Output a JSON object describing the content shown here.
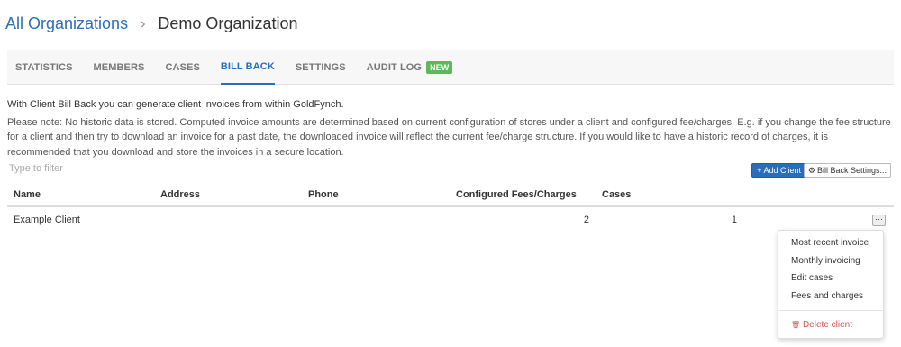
{
  "breadcrumb": {
    "parent": "All Organizations",
    "separator": "›",
    "current": "Demo Organization"
  },
  "tabs": [
    {
      "label": "STATISTICS"
    },
    {
      "label": "MEMBERS"
    },
    {
      "label": "CASES"
    },
    {
      "label": "BILL BACK",
      "active": true
    },
    {
      "label": "SETTINGS"
    },
    {
      "label": "AUDIT LOG",
      "badge": "NEW"
    }
  ],
  "intro": {
    "title": "With Client Bill Back you can generate client invoices from within GoldFynch.",
    "note": "Please note: No historic data is stored. Computed invoice amounts are determined based on current configuration of stores under a client and configured fee/charges. E.g. if you change the fee structure for a client and then try to download an invoice for a past date, the downloaded invoice will reflect the current fee/charge structure. If you would like to have a historic record of charges, it is recommended that you download and store the invoices in a secure location."
  },
  "filter": {
    "placeholder": "Type to filter",
    "value": ""
  },
  "actions": {
    "add_client_icon": "+",
    "add_client_label": "Add Client",
    "settings_icon": "⚙",
    "settings_label": "Bill Back Settings..."
  },
  "table": {
    "columns": {
      "name": "Name",
      "address": "Address",
      "phone": "Phone",
      "fees": "Configured Fees/Charges",
      "cases": "Cases"
    },
    "rows": [
      {
        "name": "Example Client",
        "address": "",
        "phone": "",
        "fees": "2",
        "cases": "1",
        "menu": "···"
      }
    ]
  },
  "row_menu": {
    "items": [
      "Most recent invoice",
      "Monthly invoicing",
      "Edit cases",
      "Fees and charges"
    ],
    "delete_icon": "🗑",
    "delete_label": "Delete client"
  },
  "colors": {
    "link": "#2a6ebb",
    "primary_button": "#2a6ebb",
    "new_badge": "#5cb85c",
    "danger": "#d9534f"
  }
}
